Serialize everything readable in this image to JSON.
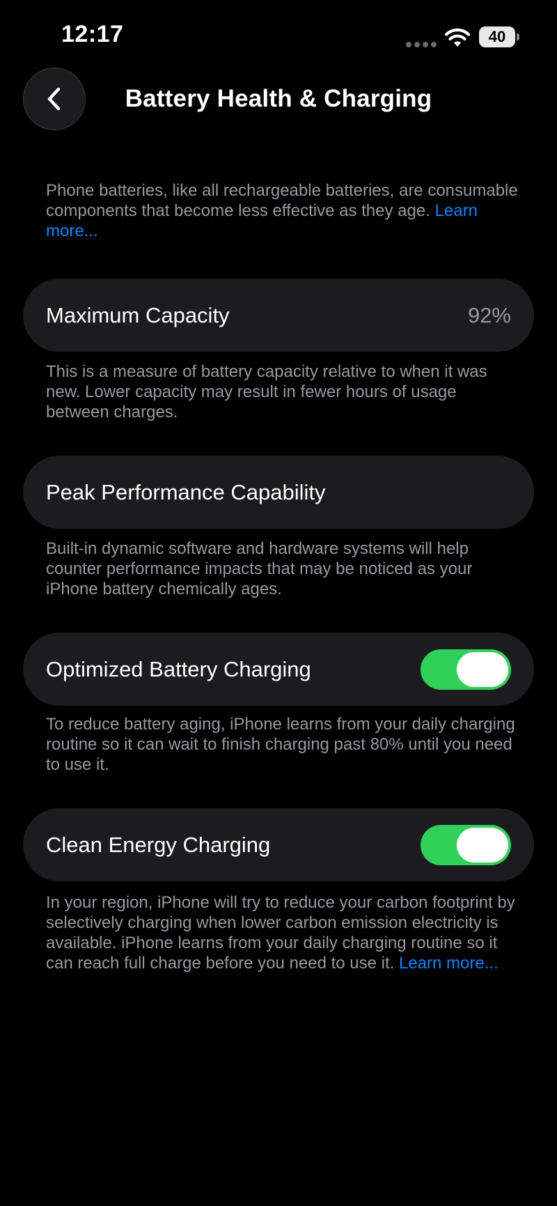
{
  "status_bar": {
    "time": "12:17",
    "battery_level": "40",
    "icons": [
      "signal-dots-icon",
      "wifi-icon",
      "battery-icon"
    ]
  },
  "nav": {
    "title": "Battery Health & Charging",
    "back_icon": "chevron-left-icon"
  },
  "intro": {
    "text": "Phone batteries, like all rechargeable batteries, are consumable components that become less effective as they age.",
    "link": "Learn more..."
  },
  "max_capacity": {
    "label": "Maximum Capacity",
    "value": "92%",
    "description": "This is a measure of battery capacity relative to when it was new. Lower capacity may result in fewer hours of usage between charges."
  },
  "peak_performance": {
    "label": "Peak Performance Capability",
    "description": "Built-in dynamic software and hardware systems will help counter performance impacts that may be noticed as your iPhone battery chemically ages."
  },
  "optimized_charging": {
    "label": "Optimized Battery Charging",
    "enabled": true,
    "description": "To reduce battery aging, iPhone learns from your daily charging routine so it can wait to finish charging past 80% until you need to use it."
  },
  "clean_energy": {
    "label": "Clean Energy Charging",
    "enabled": true,
    "description": "In your region, iPhone will try to reduce your carbon footprint by selectively charging when lower carbon emission electricity is available. iPhone learns from your daily charging routine so it can reach full charge before you need to use it.",
    "link": "Learn more..."
  },
  "colors": {
    "background": "#000000",
    "cell": "#1c1c1e",
    "secondary_text": "#98989f",
    "link": "#0a84ff",
    "toggle_on": "#30d158"
  }
}
